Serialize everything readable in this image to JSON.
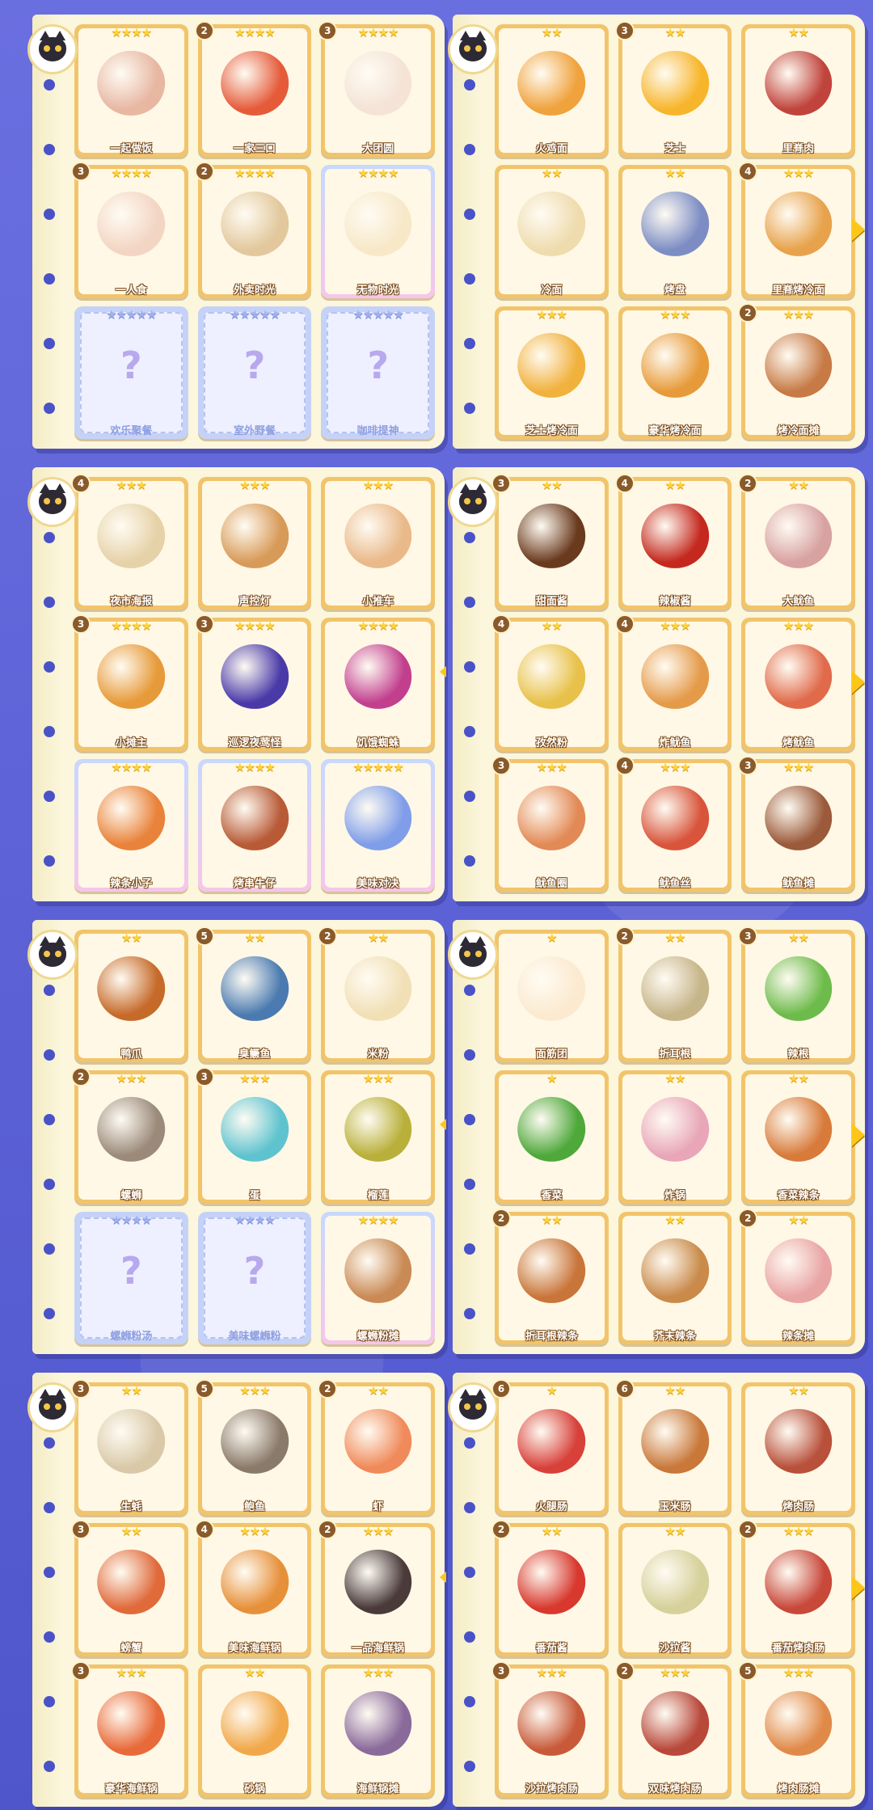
{
  "pages": [
    {
      "cards": [
        {
          "name": "一起做饭",
          "stars": "★★★★",
          "badge": "",
          "color": "#e7b7a2"
        },
        {
          "name": "一家三口",
          "stars": "★★★★",
          "badge": "2",
          "color": "#e55b3a"
        },
        {
          "name": "大团圆",
          "stars": "★★★★",
          "badge": "3",
          "color": "#f4e3d6"
        },
        {
          "name": "一人食",
          "stars": "★★★★",
          "badge": "3",
          "color": "#f3d5c3"
        },
        {
          "name": "外卖时光",
          "stars": "★★★★",
          "badge": "2",
          "color": "#e2c89c"
        },
        {
          "name": "无物时光",
          "stars": "★★★★",
          "badge": "",
          "color": "#f7e8c8",
          "special": true
        },
        {
          "name": "欢乐聚餐",
          "stars": "★★★★★",
          "badge": "",
          "locked": true
        },
        {
          "name": "室外野餐",
          "stars": "★★★★★",
          "badge": "",
          "locked": true
        },
        {
          "name": "咖啡提神",
          "stars": "★★★★★",
          "badge": "",
          "locked": true
        }
      ]
    },
    {
      "cards": [
        {
          "name": "火鸡面",
          "stars": "★★",
          "badge": "",
          "color": "#f0a23c"
        },
        {
          "name": "芝士",
          "stars": "★★",
          "badge": "3",
          "color": "#f7b52b"
        },
        {
          "name": "里脊肉",
          "stars": "★★",
          "badge": "",
          "color": "#c0443c"
        },
        {
          "name": "冷面",
          "stars": "★★",
          "badge": "",
          "color": "#efdcae"
        },
        {
          "name": "烤盘",
          "stars": "★★",
          "badge": "",
          "color": "#7d8dc4"
        },
        {
          "name": "里脊烤冷面",
          "stars": "★★★",
          "badge": "4",
          "color": "#e7a24b"
        },
        {
          "name": "芝士烤冷面",
          "stars": "★★★",
          "badge": "",
          "color": "#f1b13d"
        },
        {
          "name": "豪华烤冷面",
          "stars": "★★★",
          "badge": "",
          "color": "#e79a3a"
        },
        {
          "name": "烤冷面摊",
          "stars": "★★★",
          "badge": "2",
          "color": "#c77a45"
        }
      ]
    },
    {
      "cards": [
        {
          "name": "夜市海报",
          "stars": "★★★",
          "badge": "4",
          "color": "#e6d2a8"
        },
        {
          "name": "声控灯",
          "stars": "★★★",
          "badge": "",
          "color": "#d89a58"
        },
        {
          "name": "小推车",
          "stars": "★★★",
          "badge": "",
          "color": "#e9b98a"
        },
        {
          "name": "小摊主",
          "stars": "★★★★",
          "badge": "3",
          "color": "#e79a3a"
        },
        {
          "name": "巡逻夜莺怪",
          "stars": "★★★★",
          "badge": "3",
          "color": "#4a3aa8"
        },
        {
          "name": "饥饿蜘蛛",
          "stars": "★★★★",
          "badge": "",
          "color": "#c23f8e"
        },
        {
          "name": "辣条小子",
          "stars": "★★★★",
          "badge": "",
          "color": "#e9823a",
          "special": true
        },
        {
          "name": "烤串牛仔",
          "stars": "★★★★",
          "badge": "",
          "color": "#b85a36",
          "special": true
        },
        {
          "name": "美味对决",
          "stars": "★★★★★",
          "badge": "",
          "color": "#7f9de8",
          "special": true
        }
      ]
    },
    {
      "cards": [
        {
          "name": "甜面酱",
          "stars": "★★",
          "badge": "3",
          "color": "#6a3a1e"
        },
        {
          "name": "辣椒酱",
          "stars": "★★",
          "badge": "4",
          "color": "#c4281e"
        },
        {
          "name": "大鱿鱼",
          "stars": "★★",
          "badge": "2",
          "color": "#d8a2a2"
        },
        {
          "name": "孜然粉",
          "stars": "★★",
          "badge": "4",
          "color": "#e8c14a"
        },
        {
          "name": "炸鱿鱼",
          "stars": "★★★",
          "badge": "4",
          "color": "#e59a4a"
        },
        {
          "name": "烤鱿鱼",
          "stars": "★★★",
          "badge": "",
          "color": "#e06a4a"
        },
        {
          "name": "鱿鱼圈",
          "stars": "★★★",
          "badge": "3",
          "color": "#e28a56"
        },
        {
          "name": "鱿鱼丝",
          "stars": "★★★",
          "badge": "4",
          "color": "#d8543a"
        },
        {
          "name": "鱿鱼摊",
          "stars": "★★★",
          "badge": "3",
          "color": "#9b5a3a"
        }
      ]
    },
    {
      "cards": [
        {
          "name": "鸭爪",
          "stars": "★★",
          "badge": "",
          "color": "#c66a2a"
        },
        {
          "name": "臭鳜鱼",
          "stars": "★★",
          "badge": "5",
          "color": "#4a7ab0"
        },
        {
          "name": "米粉",
          "stars": "★★",
          "badge": "2",
          "color": "#f1e0b6"
        },
        {
          "name": "螺蛳",
          "stars": "★★★",
          "badge": "2",
          "color": "#9b8a7a"
        },
        {
          "name": "蛋",
          "stars": "★★★",
          "badge": "3",
          "color": "#5fc3cf"
        },
        {
          "name": "榴莲",
          "stars": "★★★",
          "badge": "",
          "color": "#b8b03a"
        },
        {
          "name": "螺蛳粉汤",
          "stars": "★★★★",
          "badge": "",
          "locked": true
        },
        {
          "name": "美味螺蛳粉",
          "stars": "★★★★",
          "badge": "",
          "locked": true
        },
        {
          "name": "螺蛳粉摊",
          "stars": "★★★★",
          "badge": "",
          "color": "#c98a55",
          "special": true
        }
      ]
    },
    {
      "cards": [
        {
          "name": "面筋团",
          "stars": "★",
          "badge": "",
          "color": "#fbead0"
        },
        {
          "name": "折耳根",
          "stars": "★★",
          "badge": "2",
          "color": "#c7b58a"
        },
        {
          "name": "辣根",
          "stars": "★★",
          "badge": "3",
          "color": "#6dbb4a"
        },
        {
          "name": "香菜",
          "stars": "★",
          "badge": "",
          "color": "#4ea83a"
        },
        {
          "name": "炸锅",
          "stars": "★★",
          "badge": "",
          "color": "#e8a6b8"
        },
        {
          "name": "香菜辣条",
          "stars": "★★",
          "badge": "",
          "color": "#d87a3a"
        },
        {
          "name": "折耳根辣条",
          "stars": "★★",
          "badge": "2",
          "color": "#c9753a"
        },
        {
          "name": "芥末辣条",
          "stars": "★★",
          "badge": "",
          "color": "#c98a4a"
        },
        {
          "name": "辣条摊",
          "stars": "★★",
          "badge": "2",
          "color": "#e9a4a4"
        }
      ]
    },
    {
      "cards": [
        {
          "name": "生蚝",
          "stars": "★★",
          "badge": "3",
          "color": "#d9c9a8"
        },
        {
          "name": "鲍鱼",
          "stars": "★★★",
          "badge": "5",
          "color": "#8a7a6a"
        },
        {
          "name": "虾",
          "stars": "★★",
          "badge": "2",
          "color": "#f08a5a"
        },
        {
          "name": "螃蟹",
          "stars": "★★",
          "badge": "3",
          "color": "#e06a3a"
        },
        {
          "name": "美味海鲜锅",
          "stars": "★★★",
          "badge": "4",
          "color": "#e7903a"
        },
        {
          "name": "一品海鲜锅",
          "stars": "★★★",
          "badge": "2",
          "color": "#4a3a3a"
        },
        {
          "name": "豪华海鲜锅",
          "stars": "★★★",
          "badge": "3",
          "color": "#e86a3a"
        },
        {
          "name": "砂锅",
          "stars": "★★",
          "badge": "",
          "color": "#f1a84a"
        },
        {
          "name": "海鲜锅摊",
          "stars": "★★★",
          "badge": "",
          "color": "#8a6a9a"
        }
      ]
    },
    {
      "cards": [
        {
          "name": "火腿肠",
          "stars": "★",
          "badge": "6",
          "color": "#d8403a"
        },
        {
          "name": "玉米肠",
          "stars": "★★",
          "badge": "6",
          "color": "#c9783a"
        },
        {
          "name": "烤肉肠",
          "stars": "★★",
          "badge": "",
          "color": "#b8503a"
        },
        {
          "name": "番茄酱",
          "stars": "★★",
          "badge": "2",
          "color": "#d8382e"
        },
        {
          "name": "沙拉酱",
          "stars": "★★",
          "badge": "",
          "color": "#d6d09a"
        },
        {
          "name": "番茄烤肉肠",
          "stars": "★★★",
          "badge": "2",
          "color": "#c8483a"
        },
        {
          "name": "沙拉烤肉肠",
          "stars": "★★★",
          "badge": "3",
          "color": "#c85a3a"
        },
        {
          "name": "双味烤肉肠",
          "stars": "★★★",
          "badge": "2",
          "color": "#b8483a"
        },
        {
          "name": "烤肉肠摊",
          "stars": "★★★",
          "badge": "5",
          "color": "#e08a4a"
        }
      ]
    }
  ]
}
